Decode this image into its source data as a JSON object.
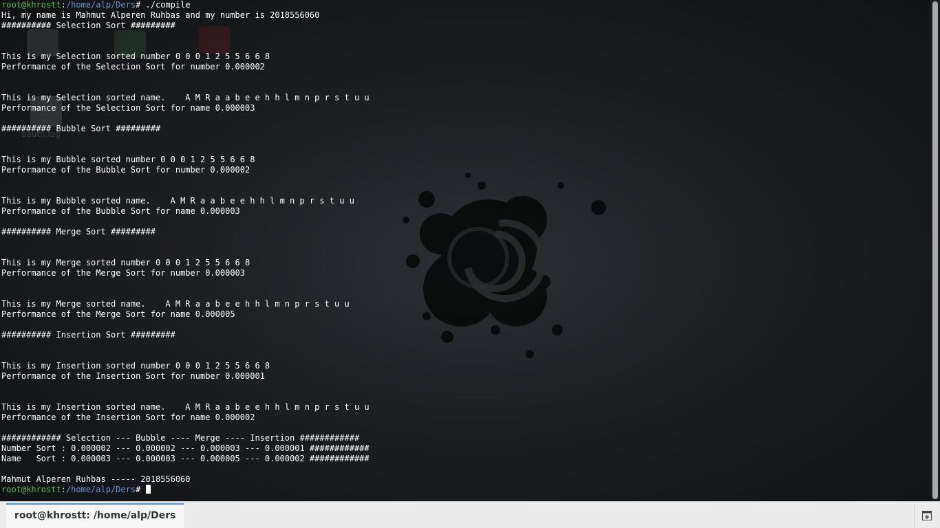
{
  "desktop": {
    "label_partial": "oauth.log"
  },
  "terminal": {
    "prompt": {
      "user_host": "root@khrostt",
      "separator": ":",
      "path": "/home/alp/Ders",
      "symbol": "#"
    },
    "command": " ./compile",
    "output": [
      "Hi, my name is Mahmut Alperen Ruhbas and my number is 2018556060",
      "########## Selection Sort #########",
      "",
      "",
      "This is my Selection sorted number 0 0 0 1 2 5 5 6 6 8",
      "Performance of the Selection Sort for number 0.000002",
      "",
      "",
      "This is my Selection sorted name.    A M R a a b e e h h l m n p r s t u u",
      "Performance of the Selection Sort for name 0.000003",
      "",
      "########## Bubble Sort #########",
      "",
      "",
      "This is my Bubble sorted number 0 0 0 1 2 5 5 6 6 8",
      "Performance of the Bubble Sort for number 0.000002",
      "",
      "",
      "This is my Bubble sorted name.    A M R a a b e e h h l m n p r s t u u",
      "Performance of the Bubble Sort for name 0.000003",
      "",
      "########## Merge Sort #########",
      "",
      "",
      "This is my Merge sorted number 0 0 0 1 2 5 5 6 6 8",
      "Performance of the Merge Sort for number 0.000003",
      "",
      "",
      "This is my Merge sorted name.    A M R a a b e e h h l m n p r s t u u",
      "Performance of the Merge Sort for name 0.000005",
      "",
      "########## Insertion Sort #########",
      "",
      "",
      "This is my Insertion sorted number 0 0 0 1 2 5 5 6 6 8",
      "Performance of the Insertion Sort for number 0.000001",
      "",
      "",
      "This is my Insertion sorted name.    A M R a a b e e h h l m n p r s t u u",
      "Performance of the Insertion Sort for name 0.000002",
      "",
      "############ Selection --- Bubble ---- Merge ---- Insertion ############",
      "Number Sort : 0.000002 --- 0.000002 --- 0.000003 --- 0.000001 ############",
      "Name   Sort : 0.000003 --- 0.000003 --- 0.000005 --- 0.000002 ############",
      "",
      "Mahmut Alperen Ruhbas ----- 2018556060"
    ]
  },
  "taskbar": {
    "window_title": "root@khrostt: /home/alp/Ders",
    "workspace_icon": "add-workspace-icon"
  },
  "colors": {
    "prompt_user": "#5fba57",
    "prompt_path": "#6f95d5",
    "terminal_text": "#ffffff",
    "taskbar_bg": "#ececec",
    "active_indicator": "#4a90d9"
  }
}
